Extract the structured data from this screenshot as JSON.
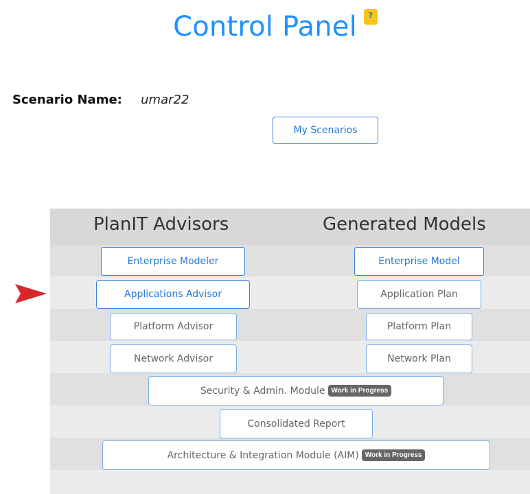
{
  "header": {
    "title": "Control Panel",
    "help_badge": "?"
  },
  "scenario": {
    "label": "Scenario Name:",
    "value": "umar22",
    "my_scenarios_button": "My Scenarios"
  },
  "columns": {
    "advisors": "PlanIT Advisors",
    "models": "Generated Models"
  },
  "advisors": {
    "enterprise_modeler": "Enterprise Modeler",
    "applications_advisor": "Applications Advisor",
    "platform_advisor": "Platform Advisor",
    "network_advisor": "Network Advisor"
  },
  "models": {
    "enterprise_model": "Enterprise Model",
    "application_plan": "Application Plan",
    "platform_plan": "Platform Plan",
    "network_plan": "Network Plan"
  },
  "modules": {
    "security_admin": "Security & Admin. Module",
    "consolidated_report": "Consolidated Report",
    "aim": "Architecture & Integration Module (AIM)",
    "wip_badge": "Work in Progress"
  },
  "colors": {
    "title": "#1E90FF",
    "help_badge_bg": "#F5C518",
    "arrow": "#D9262B",
    "row_dark": "#E0E0E0",
    "row_light": "#EBEBEB",
    "header_bg": "#D8D8D8",
    "badge_bg": "#666666",
    "active_button_text": "#2379D8"
  },
  "icons": {
    "pointer": "red-pointer-arrow-icon"
  }
}
